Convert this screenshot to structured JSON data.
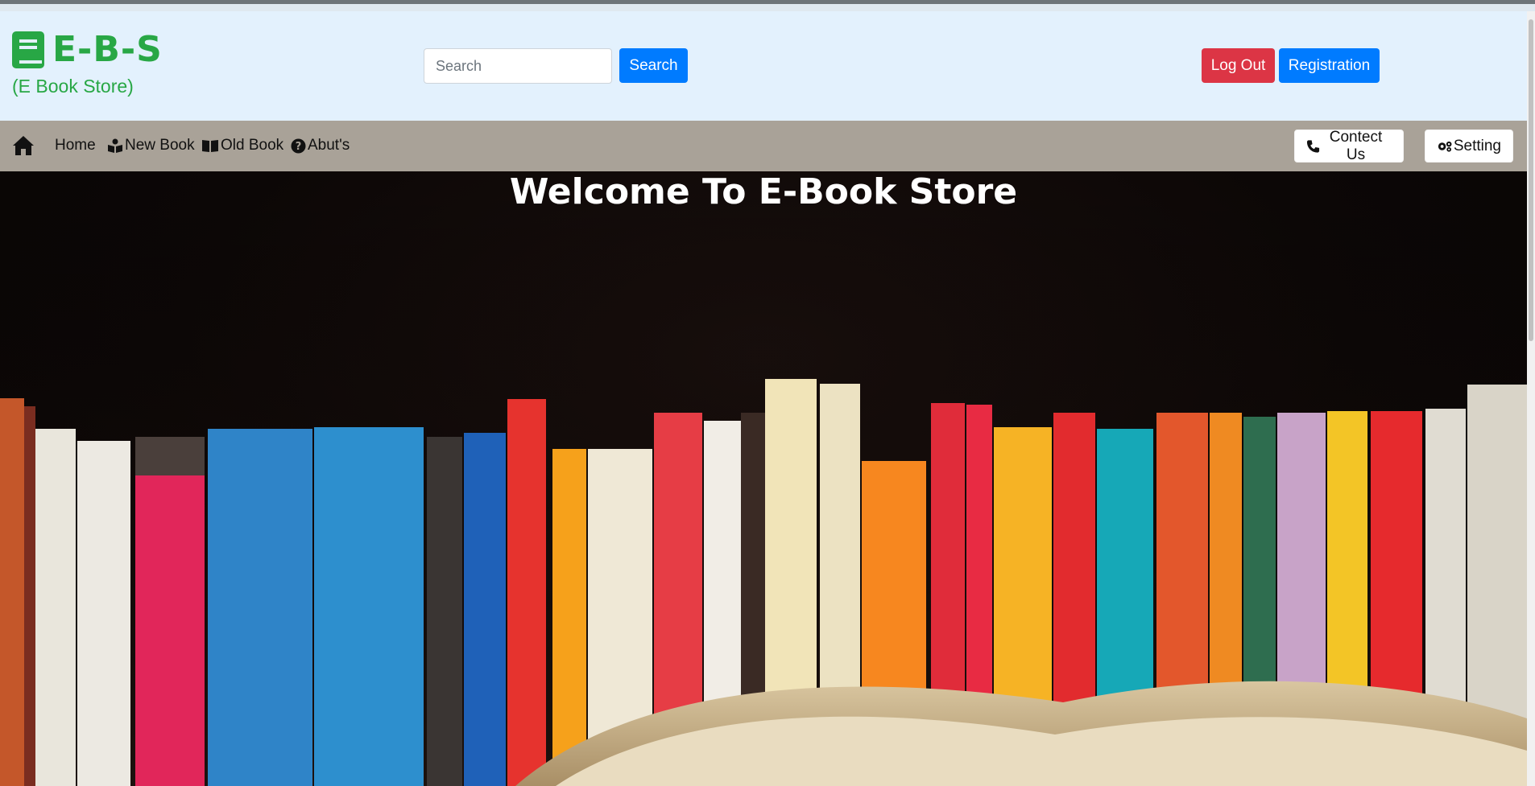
{
  "brand": {
    "title": "E-B-S",
    "subtitle": "(E Book Store)",
    "logo_icon": "book-icon",
    "color": "#28a745"
  },
  "search": {
    "placeholder": "Search",
    "button_label": "Search"
  },
  "auth": {
    "logout_label": "Log Out",
    "register_label": "Registration"
  },
  "nav": {
    "home_icon": "home-icon",
    "items": [
      {
        "label": "Home",
        "icon": ""
      },
      {
        "label": "New Book",
        "icon": "reader-icon"
      },
      {
        "label": "Old Book",
        "icon": "open-book-icon"
      },
      {
        "label": "Abut's",
        "icon": "question-circle-icon"
      }
    ],
    "contact": {
      "label": "Contect Us",
      "icon": "phone-icon"
    },
    "setting": {
      "label": "Setting",
      "icon": "gears-icon"
    }
  },
  "hero": {
    "title": "Welcome To E-Book Store",
    "image": "bookshelf-with-open-book"
  },
  "colors": {
    "header_bg": "#e3f1fd",
    "navbar_bg": "#a9a298",
    "primary": "#007bff",
    "danger": "#dc3545"
  }
}
